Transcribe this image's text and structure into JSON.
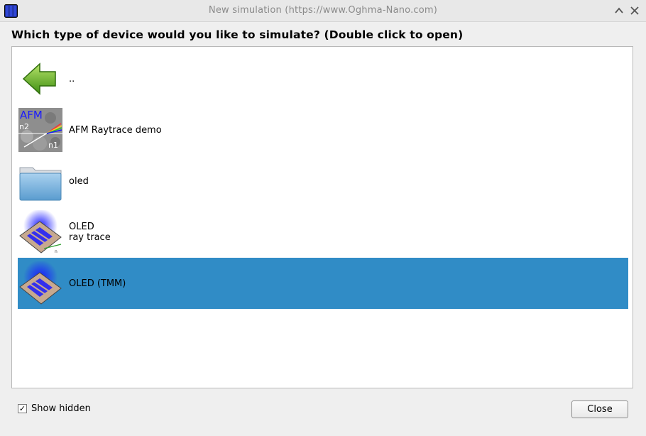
{
  "window": {
    "title": "New simulation (https://www.Oghma-Nano.com)",
    "minimize_icon": "chevron-up-icon",
    "close_icon": "close-icon"
  },
  "heading": "Which type of device would you like to simulate? (Double click to open)",
  "items": [
    {
      "icon": "back-arrow-icon",
      "label": ".."
    },
    {
      "icon": "afm-raytrace-thumbnail",
      "label": "AFM Raytrace demo",
      "thumb_text": {
        "title": "AFM",
        "n2": "n2",
        "n1": "n1"
      }
    },
    {
      "icon": "folder-icon",
      "label": "oled"
    },
    {
      "icon": "oled-raytrace-thumbnail",
      "label": "OLED\nray trace"
    },
    {
      "icon": "oled-tmm-thumbnail",
      "label": "OLED (TMM)",
      "selected": true
    }
  ],
  "footer": {
    "show_hidden_label": "Show hidden",
    "show_hidden_checked": true,
    "check_mark": "✓",
    "close_label": "Close"
  },
  "colors": {
    "selection": "#308cc6",
    "accent_blue": "#1a1aff"
  }
}
